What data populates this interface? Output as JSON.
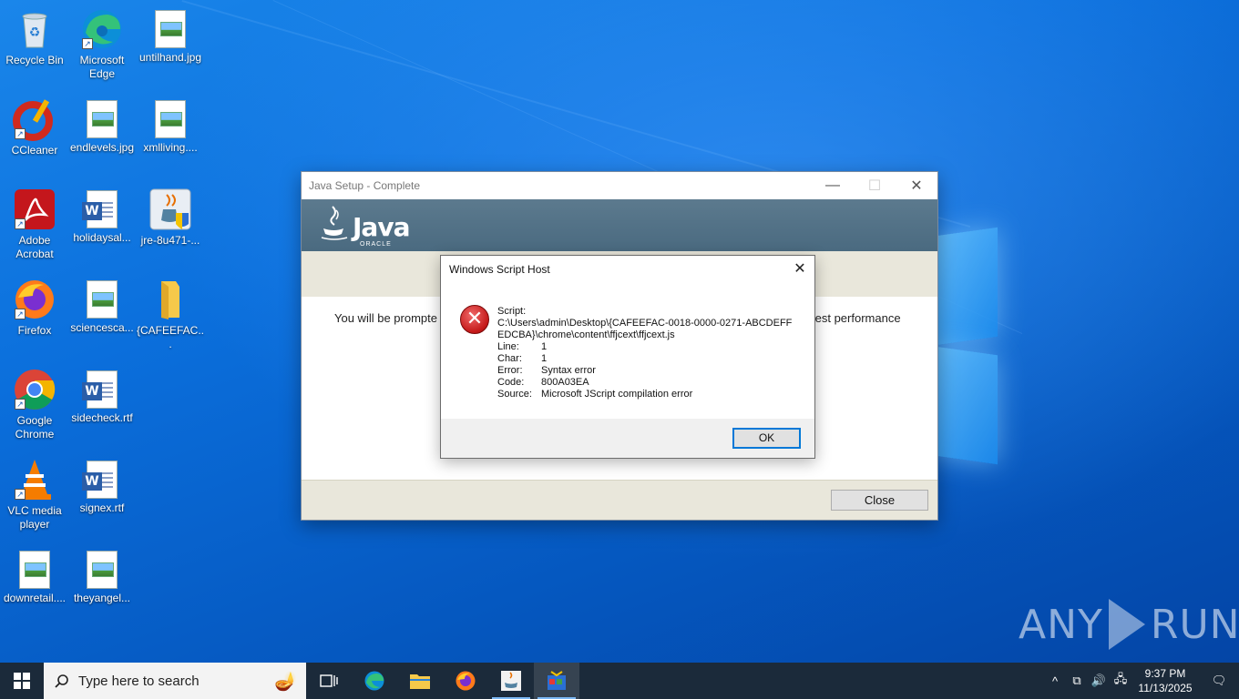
{
  "desktop": {
    "icons": [
      {
        "label": "Recycle Bin"
      },
      {
        "label": "Microsoft Edge"
      },
      {
        "label": "untilhand.jpg"
      },
      {
        "label": "CCleaner"
      },
      {
        "label": "endlevels.jpg"
      },
      {
        "label": "xmlliving...."
      },
      {
        "label": "Adobe Acrobat"
      },
      {
        "label": "holidaysal..."
      },
      {
        "label": "jre-8u471-..."
      },
      {
        "label": "Firefox"
      },
      {
        "label": "sciencesca..."
      },
      {
        "label": "{CAFEEFAC..."
      },
      {
        "label": "Google Chrome"
      },
      {
        "label": "sidecheck.rtf"
      },
      {
        "label": "VLC media player"
      },
      {
        "label": "signex.rtf"
      },
      {
        "label": "downretail...."
      },
      {
        "label": "theyangel..."
      }
    ]
  },
  "java_window": {
    "title": "Java Setup - Complete",
    "logo_text": "Java",
    "logo_sub": "ORACLE",
    "message_left": "You will be prompte",
    "message_right": "test performance",
    "close_label": "Close"
  },
  "wsh_dialog": {
    "title": "Windows Script Host",
    "script_label": "Script:",
    "script_path_line1": "C:\\Users\\admin\\Desktop\\{CAFEEFAC-0018-0000-0271-ABCDEFF",
    "script_path_line2": "EDCBA}\\chrome\\content\\ffjcext\\ffjcext.js",
    "fields": [
      {
        "key": "Line:",
        "value": "1"
      },
      {
        "key": "Char:",
        "value": "1"
      },
      {
        "key": "Error:",
        "value": "Syntax error"
      },
      {
        "key": "Code:",
        "value": "800A03EA"
      },
      {
        "key": "Source:",
        "value": "Microsoft JScript compilation error"
      }
    ],
    "ok_label": "OK"
  },
  "watermark": {
    "left": "ANY",
    "right": "RUN"
  },
  "taskbar": {
    "search_placeholder": "Type here to search",
    "time": "9:37 PM",
    "date": "11/13/2025"
  },
  "colors": {
    "taskbar": "#1b2a3a",
    "java_banner": "#4a6a80",
    "error_red": "#c41818"
  }
}
